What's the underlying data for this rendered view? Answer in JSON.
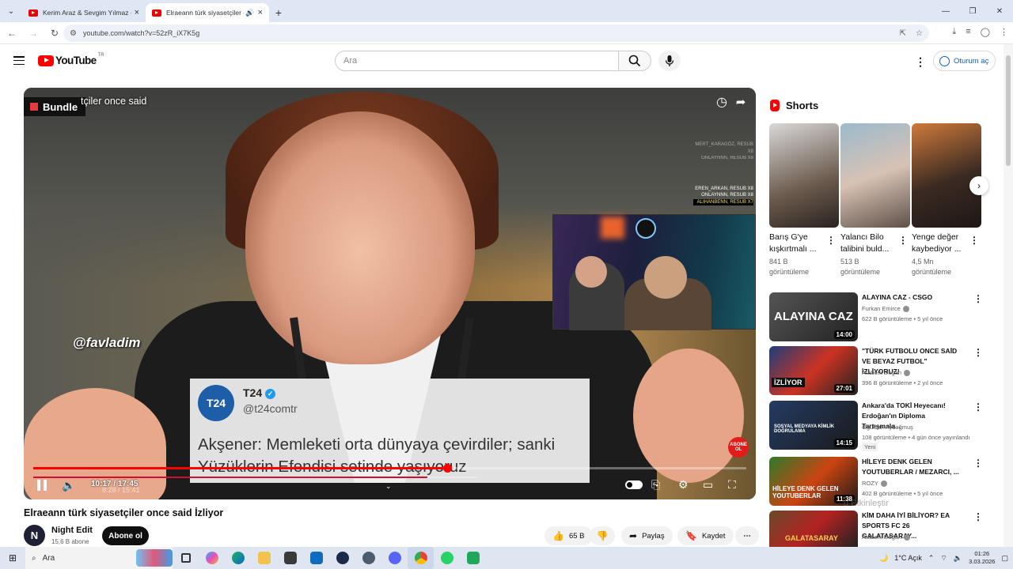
{
  "browser": {
    "tabs": [
      {
        "title": "Kerim Araz & Sevgim Yılmaz - D",
        "active": false
      },
      {
        "title": "Elraeann türk siyasetçiler on",
        "active": true
      }
    ],
    "url": "youtube.com/watch?v=52zR_iX7K5g"
  },
  "header": {
    "logo_text": "YouTube",
    "region": "TR",
    "search_placeholder": "Ara",
    "signin_label": "Oturum aç"
  },
  "video": {
    "brand": "Bundle",
    "overlay_title": "tçiler once said",
    "watermark_tag": "@favladim",
    "subs_lines": [
      "MERT_KARAGÖZ, RESUB X8",
      "ONLAYNNN, RESUB X8",
      "EREN_ARKAN, RESUB X8",
      "ALIHANBENN, RESUB X7"
    ],
    "tweet": {
      "logo": "T24",
      "name": "T24",
      "handle": "@t24comtr",
      "body": "Akşener: Memleketi orta dünyaya çevirdiler; sanki Yüzüklerin Efendisi setinde yaşıyoruz"
    },
    "abone_badge": "ABONE OL",
    "time_display": "10:17 / 17:45",
    "time_ghost": "8:28 / 15:41",
    "progress_fraction": 0.58,
    "ghost_progress_fraction": 0.89
  },
  "below": {
    "title": "Elraeann türk siyasetçiler once said İzliyor",
    "channel": "Night Edit",
    "channel_initial": "N",
    "subs": "15,6 B abone",
    "subscribe_label": "Abone ol",
    "likes": "65 B",
    "share_label": "Paylaş",
    "save_label": "Kaydet"
  },
  "shorts": {
    "heading": "Shorts",
    "items": [
      {
        "title": "Barış G'ye kışkırtmalı ...",
        "views": "841 B görüntüleme"
      },
      {
        "title": "Yalancı Bilo talibini buld...",
        "views": "513 B görüntüleme"
      },
      {
        "title": "Yenge değer kaybediyor ...",
        "views": "4,5 Mn görüntüleme"
      }
    ]
  },
  "recommendations": [
    {
      "title": "ALAYINA CAZ - CSGO",
      "channel": "Furkan Emirce",
      "meta": "622 B görüntüleme • 5 yıl önce",
      "duration": "14:00",
      "thumb_text": "ALAYINA CAZ"
    },
    {
      "title": "\"TÜRK FUTBOLU ONCE SAİD VE BEYAZ FUTBOL\" İZLİYORUZ!",
      "channel": "Ataberk Doğan",
      "meta": "396 B görüntüleme • 2 yıl önce",
      "duration": "27:01",
      "thumb_text": "İZLİYOR"
    },
    {
      "title": "Ankara'da TOKİ Heyecanı! Erdoğan'ın Diploma Tartışmala...",
      "channel": "Oğulcan Aydoğmuş",
      "meta": "108 görüntüleme • 4 gün önce yayınlandı",
      "duration": "14:15",
      "badge": "Yeni",
      "thumb_text": "SOSYAL MEDYAYA KİMLİK DOĞRULAMA"
    },
    {
      "title": "HİLEYE DENK GELEN YOUTUBERLAR / MEZARCI, ...",
      "channel": "ROZY",
      "meta": "402 B görüntüleme • 5 yıl önce",
      "duration": "11:38",
      "thumb_text": "HİLEYE DENK GELEN YOUTUBERLAR"
    },
    {
      "title": "KİM DAHA İYİ BİLİYOR? EA SPORTS FC 26 GALATASARAY...",
      "channel": "Ataberk Doğan",
      "meta": "",
      "duration": "",
      "thumb_text": "GALATASARAY"
    }
  ],
  "overlay_watermark": "u Etkinleştir",
  "taskbar": {
    "search_label": "Ara",
    "weather": "1°C Açık",
    "time": "01:26",
    "date": "3.03.2026"
  },
  "colors": {
    "brand_red": "#FF0000",
    "link_blue": "#065FD4"
  }
}
